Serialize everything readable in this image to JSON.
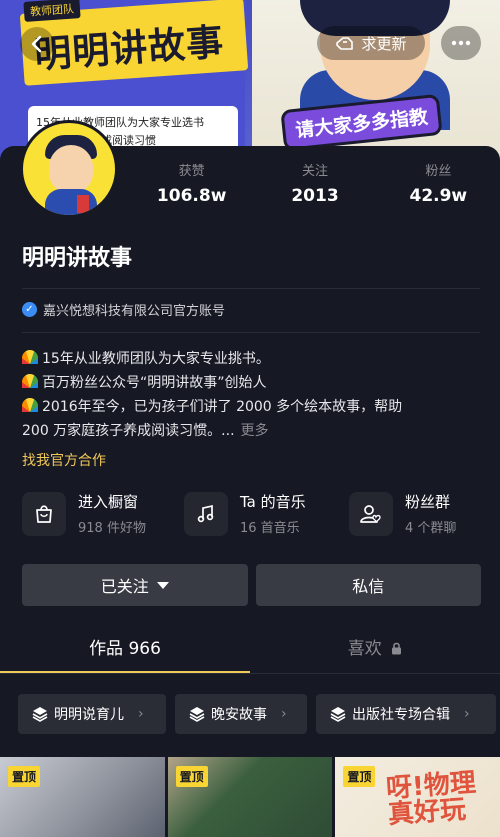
{
  "banner": {
    "tag": "教师团队",
    "title": "明明讲故事",
    "card_line1": "15年从业教师团队为大家专业选书",
    "card_line2": "帮助孩子养成阅读习惯",
    "slogan": "请大家多多指教"
  },
  "header": {
    "back_icon": "chevron-left-icon",
    "refresh_label": "求更新",
    "refresh_icon": "hand-icon",
    "more_icon": "more-dots-icon"
  },
  "profile": {
    "stats": [
      {
        "label": "获赞",
        "value": "106.8w"
      },
      {
        "label": "关注",
        "value": "2013"
      },
      {
        "label": "粉丝",
        "value": "42.9w"
      }
    ],
    "name": "明明讲故事",
    "verified_text": "嘉兴悦想科技有限公司官方账号",
    "bio": [
      "15年从业教师团队为大家专业挑书。",
      "百万粉丝公众号“明明讲故事”创始人",
      "2016年至今，已为孩子们讲了 2000 多个绘本故事，帮助",
      "200 万家庭孩子养成阅读习惯。..."
    ],
    "bio_more": "更多",
    "partner_link": "找我官方合作"
  },
  "services": [
    {
      "title": "进入橱窗",
      "sub": "918 件好物",
      "icon": "shopping-bag-icon"
    },
    {
      "title": "Ta 的音乐",
      "sub": "16 首音乐",
      "icon": "music-note-icon"
    },
    {
      "title": "粉丝群",
      "sub": "4 个群聊",
      "icon": "fan-group-icon"
    }
  ],
  "actions": {
    "followed_label": "已关注",
    "message_label": "私信"
  },
  "tabs": [
    {
      "label": "作品 966"
    },
    {
      "label": "喜欢"
    }
  ],
  "collections": [
    {
      "label": "明明说育儿"
    },
    {
      "label": "晚安故事"
    },
    {
      "label": "出版社专场合辑"
    }
  ],
  "thumbs": [
    {
      "pin": "置顶"
    },
    {
      "pin": "置顶"
    },
    {
      "pin": "置顶",
      "title": "呀!物理\n真好玩"
    }
  ],
  "colors": {
    "background": "#161823",
    "accent": "#f0c85a",
    "verify_blue": "#3b8df5",
    "pin_yellow": "#f8d532"
  }
}
